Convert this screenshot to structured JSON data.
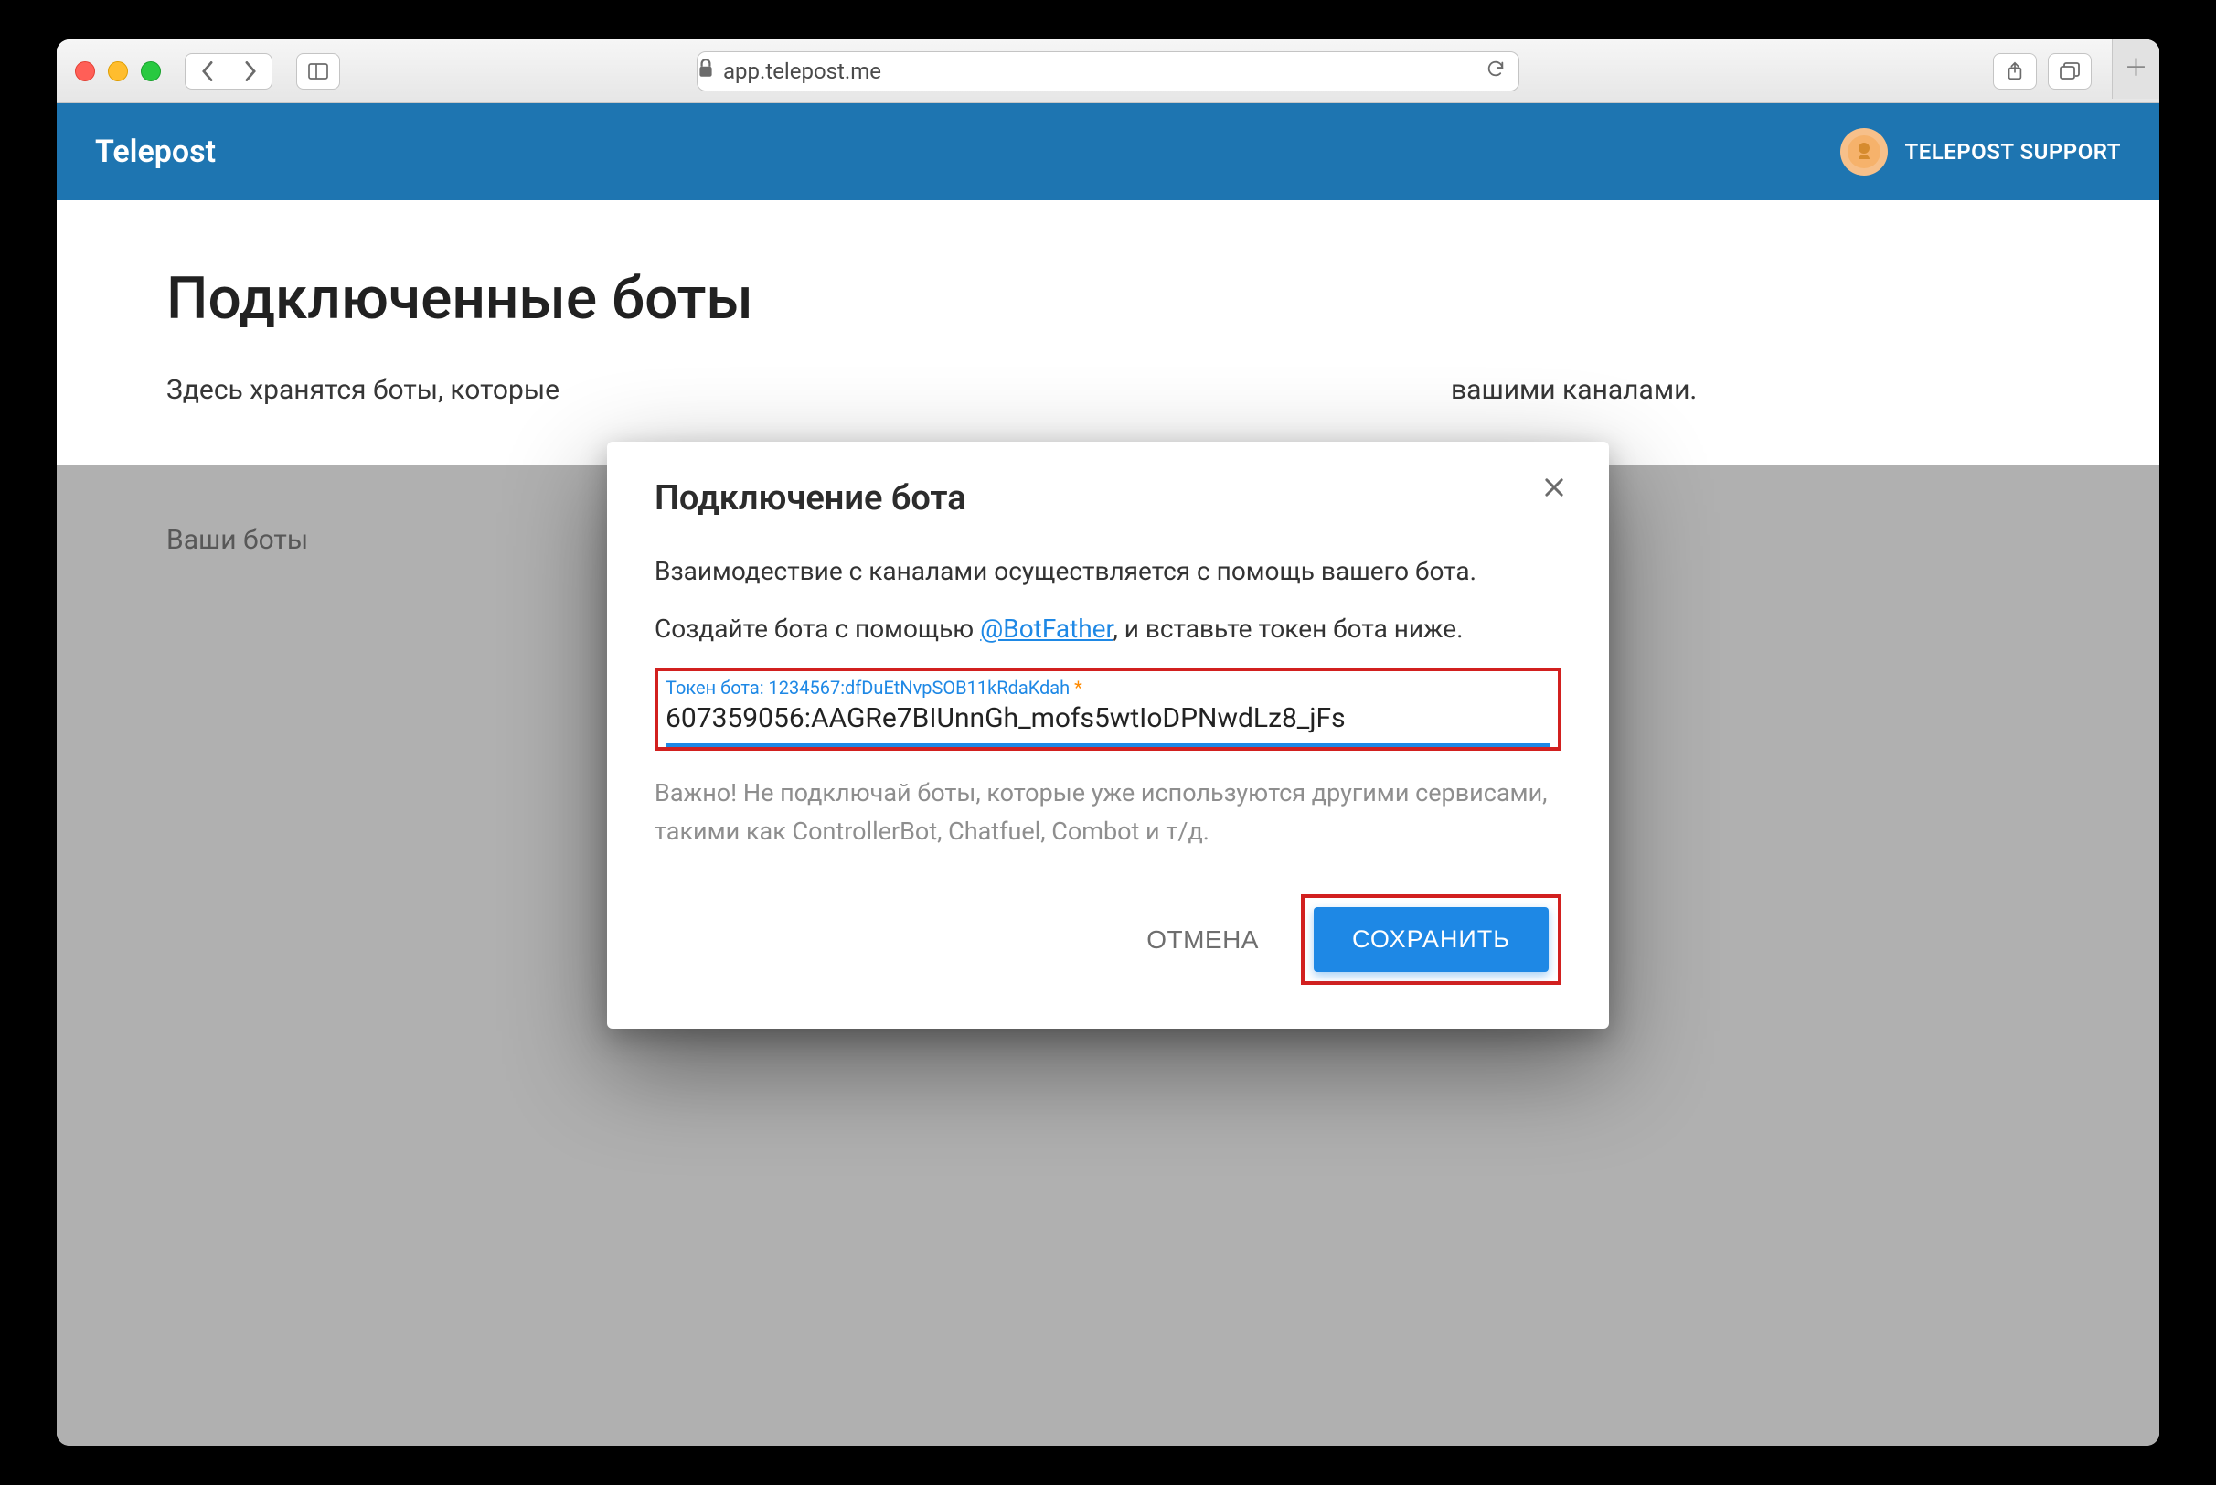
{
  "browser": {
    "url": "app.telepost.me"
  },
  "header": {
    "brand": "Telepost",
    "username": "TELEPOST SUPPORT"
  },
  "page": {
    "title": "Подключенные боты",
    "subtitle_prefix": "Здесь хранятся боты, которые",
    "subtitle_suffix": "вашими каналами.",
    "your_bots_label": "Ваши боты"
  },
  "dialog": {
    "title": "Подключение бота",
    "line1": "Взаимодествие с каналами осуществляется с помощь вашего бота.",
    "line2_before": "Создайте бота с помощью ",
    "line2_link": "@BotFather",
    "line2_after": ", и вставьте токен бота ниже.",
    "field_label": "Токен бота: 1234567:dfDuEtNvpSOB11kRdaKdah",
    "field_required_mark": "*",
    "field_value": "607359056:AAGRe7BIUnnGh_mofs5wtIoDPNwdLz8_jFs",
    "warn": "Важно! Не подключай боты, которые уже используются другими сервисами, такими как ControllerBot, Chatfuel, Combot и т/д.",
    "cancel": "ОТМЕНА",
    "save": "СОХРАНИТЬ"
  }
}
